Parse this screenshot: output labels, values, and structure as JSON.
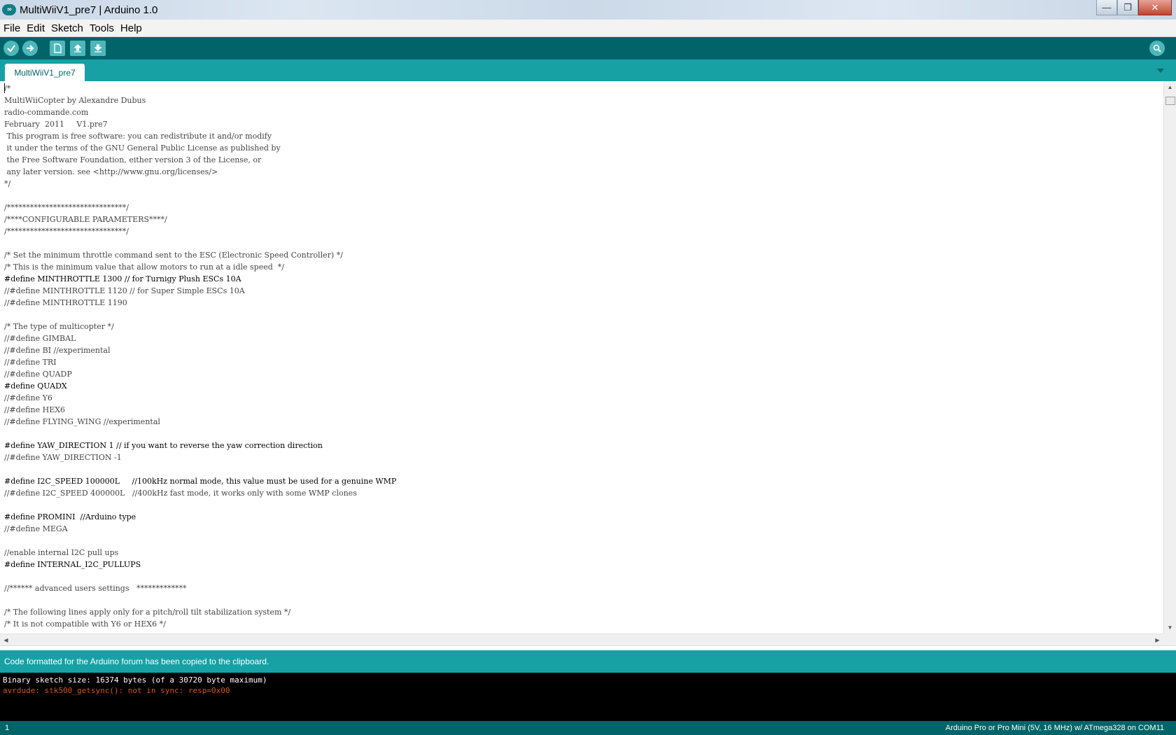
{
  "window": {
    "title": "MultiWiiV1_pre7 | Arduino 1.0",
    "logo_text": "∞",
    "controls": {
      "minimize": "—",
      "maximize": "❐",
      "close": "✕"
    }
  },
  "menu": [
    "File",
    "Edit",
    "Sketch",
    "Tools",
    "Help"
  ],
  "toolbar": {
    "buttons": [
      "verify-icon",
      "upload-icon",
      "new-icon",
      "open-icon",
      "save-icon"
    ],
    "right_button": "serial-monitor-icon"
  },
  "tabs": {
    "active": "MultiWiiV1_pre7",
    "menu_icon": "tab-menu-icon"
  },
  "editor": {
    "lines": [
      "/*",
      "MultiWiiCopter by Alexandre Dubus",
      "radio-commande.com",
      "February  2011     V1.pre7",
      " This program is free software: you can redistribute it and/or modify",
      " it under the terms of the GNU General Public License as published by",
      " the Free Software Foundation, either version 3 of the License, or",
      " any later version. see <http://www.gnu.org/licenses/>",
      "*/",
      "",
      "/*******************************/",
      "/****CONFIGURABLE PARAMETERS****/",
      "/*******************************/",
      "",
      "/* Set the minimum throttle command sent to the ESC (Electronic Speed Controller) */",
      "/* This is the minimum value that allow motors to run at a idle speed  */",
      "#define MINTHROTTLE 1300 // for Turnigy Plush ESCs 10A",
      "//#define MINTHROTTLE 1120 // for Super Simple ESCs 10A",
      "//#define MINTHROTTLE 1190",
      "",
      "/* The type of multicopter */",
      "//#define GIMBAL",
      "//#define BI //experimental",
      "//#define TRI",
      "//#define QUADP",
      "#define QUADX",
      "//#define Y6",
      "//#define HEX6",
      "//#define FLYING_WING //experimental",
      "",
      "#define YAW_DIRECTION 1 // if you want to reverse the yaw correction direction",
      "//#define YAW_DIRECTION -1",
      "",
      "#define I2C_SPEED 100000L     //100kHz normal mode, this value must be used for a genuine WMP",
      "//#define I2C_SPEED 400000L   //400kHz fast mode, it works only with some WMP clones",
      "",
      "#define PROMINI  //Arduino type",
      "//#define MEGA",
      "",
      "//enable internal I2C pull ups",
      "#define INTERNAL_I2C_PULLUPS",
      "",
      "//****** advanced users settings   *************",
      "",
      "/* The following lines apply only for a pitch/roll tilt stabilization system */",
      "/* It is not compatible with Y6 or HEX6 */"
    ]
  },
  "status": {
    "message": "Code formatted for the Arduino forum  has been copied to the clipboard."
  },
  "console": {
    "lines": [
      {
        "text": "Binary sketch size: 16374 bytes (of a 30720 byte maximum)",
        "kind": "normal"
      },
      {
        "text": "avrdude: stk500_getsync(): not in sync: resp=0x00",
        "kind": "error"
      }
    ]
  },
  "footer": {
    "line_number": "1",
    "board": "Arduino Pro or Pro Mini (5V, 16 MHz) w/ ATmega328 on COM11"
  },
  "colors": {
    "toolbar": "#006468",
    "tabstrip": "#17a1a5",
    "console_error": "#d4531d"
  }
}
